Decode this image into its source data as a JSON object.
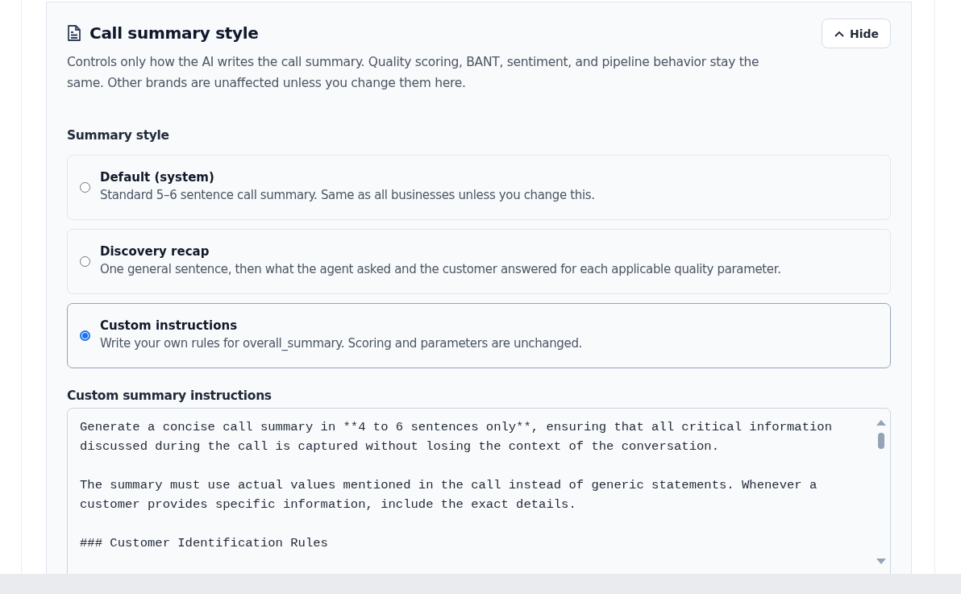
{
  "section": {
    "title": "Call summary style",
    "description": "Controls only how the AI writes the call summary. Quality scoring, BANT, sentiment, and pipeline behavior stay the same. Other brands are unaffected unless you change them here.",
    "hide_button": "Hide"
  },
  "summary_style": {
    "label": "Summary style",
    "options": [
      {
        "title": "Default (system)",
        "description": "Standard 5–6 sentence call summary. Same as all businesses unless you change this.",
        "selected": false
      },
      {
        "title": "Discovery recap",
        "description": "One general sentence, then what the agent asked and the customer answered for each applicable quality parameter.",
        "selected": false
      },
      {
        "title": "Custom instructions",
        "description": "Write your own rules for overall_summary. Scoring and parameters are unchanged.",
        "selected": true
      }
    ]
  },
  "custom_instructions": {
    "label": "Custom summary instructions",
    "value": "Generate a concise call summary in **4 to 6 sentences only**, ensuring that all critical information discussed during the call is captured without losing the context of the conversation.\n\nThe summary must use actual values mentioned in the call instead of generic statements. Whenever a customer provides specific information, include the exact details.\n\n### Customer Identification Rules"
  }
}
